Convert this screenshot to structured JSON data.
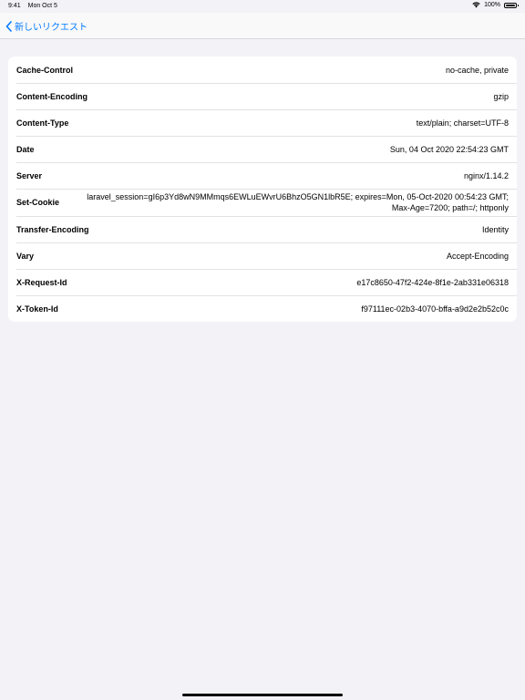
{
  "status_bar": {
    "time": "9:41",
    "date": "Mon Oct 5",
    "battery_percent": "100%"
  },
  "nav": {
    "back_label": "新しいリクエスト"
  },
  "headers": [
    {
      "key": "Cache-Control",
      "value": "no-cache, private"
    },
    {
      "key": "Content-Encoding",
      "value": "gzip"
    },
    {
      "key": "Content-Type",
      "value": "text/plain; charset=UTF-8"
    },
    {
      "key": "Date",
      "value": "Sun, 04 Oct 2020 22:54:23 GMT"
    },
    {
      "key": "Server",
      "value": "nginx/1.14.2"
    },
    {
      "key": "Set-Cookie",
      "value": "laravel_session=gI6p3Yd8wN9MMmqs6EWLuEWvrU6BhzO5GN1lbR5E; expires=Mon, 05-Oct-2020 00:54:23 GMT; Max-Age=7200; path=/; httponly"
    },
    {
      "key": "Transfer-Encoding",
      "value": "Identity"
    },
    {
      "key": "Vary",
      "value": "Accept-Encoding"
    },
    {
      "key": "X-Request-Id",
      "value": "e17c8650-47f2-424e-8f1e-2ab331e06318"
    },
    {
      "key": "X-Token-Id",
      "value": "f97111ec-02b3-4070-bffa-a9d2e2b52c0c"
    }
  ],
  "colors": {
    "accent": "#007aff",
    "background": "#f2f2f7",
    "card": "#ffffff"
  }
}
